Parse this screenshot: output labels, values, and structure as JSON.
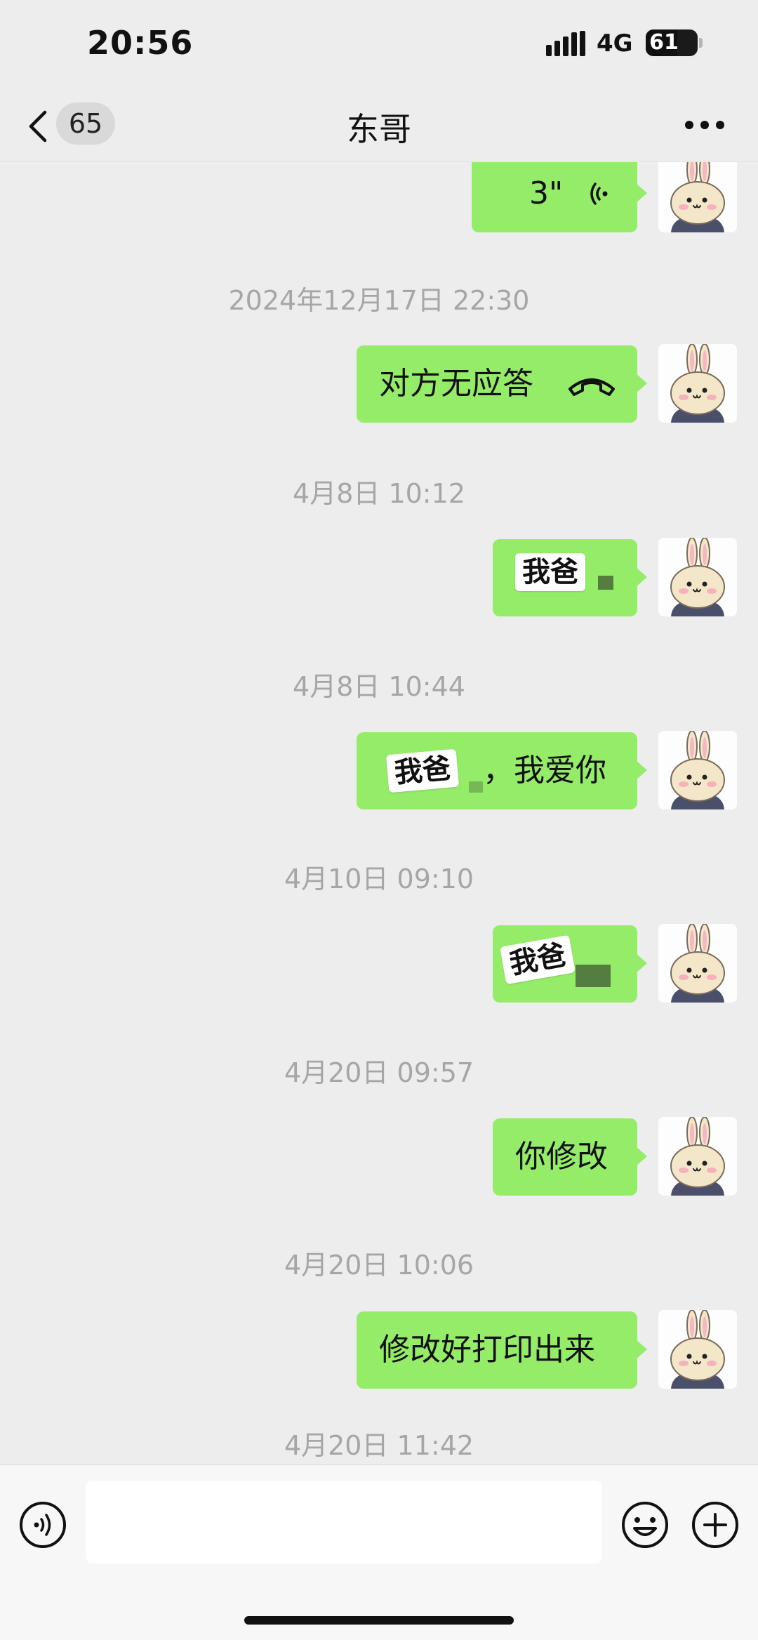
{
  "status_bar": {
    "time": "20:56",
    "network": "4G",
    "battery": "61",
    "battery_level": 0.61
  },
  "header": {
    "unread_count": "65",
    "title": "东哥"
  },
  "messages": [
    {
      "type": "voice",
      "duration": "3\""
    },
    {
      "type": "timestamp",
      "text": "2024年12月17日 22:30"
    },
    {
      "type": "call",
      "text": "对方无应答"
    },
    {
      "type": "timestamp",
      "text": "4月8日 10:12"
    },
    {
      "type": "sticker",
      "text": "我爸"
    },
    {
      "type": "timestamp",
      "text": "4月8日 10:44"
    },
    {
      "type": "mixed",
      "sticker": "我爸",
      "text": "，我爱你"
    },
    {
      "type": "timestamp",
      "text": "4月10日 09:10"
    },
    {
      "type": "sticker",
      "text": "我爸"
    },
    {
      "type": "timestamp",
      "text": "4月20日 09:57"
    },
    {
      "type": "text",
      "text": "你修改"
    },
    {
      "type": "timestamp",
      "text": "4月20日 10:06"
    },
    {
      "type": "text",
      "text": "修改好打印出来"
    },
    {
      "type": "timestamp",
      "text": "4月20日 11:42"
    }
  ],
  "input_bar": {
    "placeholder": "",
    "voice_icon": "voice-icon",
    "emoji_icon": "emoji-icon",
    "plus_icon": "plus-icon"
  },
  "colors": {
    "bubble": "#95ec69",
    "background": "#ededed",
    "timestamp": "#a6a6a6"
  }
}
